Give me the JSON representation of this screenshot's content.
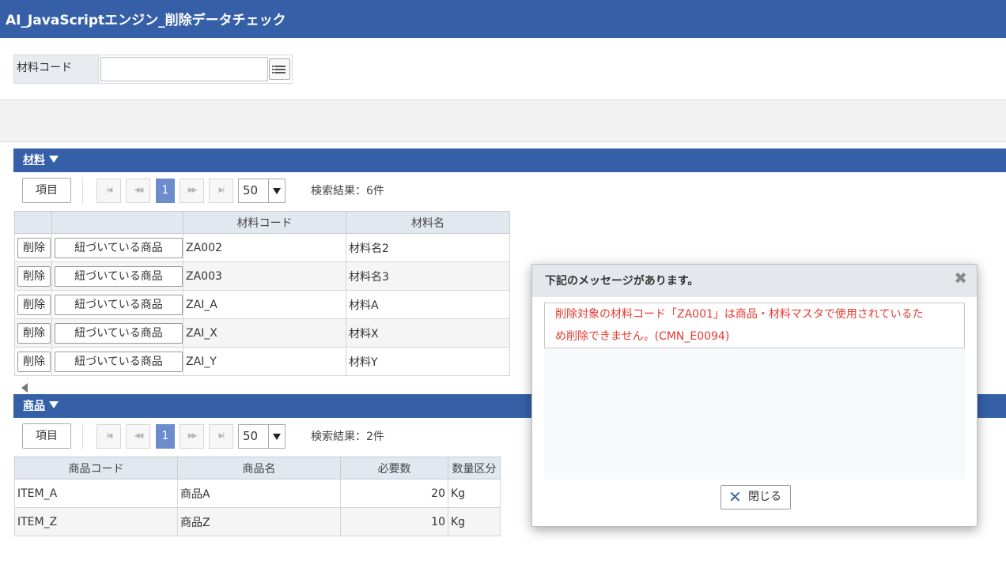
{
  "app": {
    "title": "AI_JavaScriptエンジン_削除データチェック"
  },
  "search": {
    "label": "材料コード",
    "value": "",
    "list_icon": "list-icon"
  },
  "materials": {
    "title": "材料",
    "item_button": "項目",
    "pager": {
      "first": "first-page-icon",
      "prev": "prev-page-icon",
      "current": "1",
      "next": "next-page-icon",
      "last": "last-page-icon",
      "per_page": "50"
    },
    "result_text": "検索結果：6件",
    "columns": [
      "",
      "",
      "材料コード",
      "材料名"
    ],
    "delete_label": "削除",
    "linked_label": "紐づいている商品",
    "rows": [
      {
        "code": "ZA002",
        "name": "材料名2"
      },
      {
        "code": "ZA003",
        "name": "材料名3"
      },
      {
        "code": "ZAI_A",
        "name": "材料A"
      },
      {
        "code": "ZAI_X",
        "name": "材料X"
      },
      {
        "code": "ZAI_Y",
        "name": "材料Y"
      }
    ]
  },
  "products": {
    "title": "商品",
    "item_button": "項目",
    "pager": {
      "current": "1",
      "per_page": "50"
    },
    "result_text": "検索結果：2件",
    "columns": [
      "商品コード",
      "商品名",
      "必要数",
      "数量区分"
    ],
    "rows": [
      {
        "code": "ITEM_A",
        "name": "商品A",
        "qty": "20",
        "unit": "Kg"
      },
      {
        "code": "ITEM_Z",
        "name": "商品Z",
        "qty": "10",
        "unit": "Kg"
      }
    ]
  },
  "dialog": {
    "title": "下記のメッセージがあります。",
    "message_line1": "削除対象の材料コード「ZA001」は商品・材料マスタで使用されているた",
    "message_line2": "め削除できません。(CMN_E0094)",
    "close_label": "閉じる"
  },
  "colors": {
    "header": "#3560a8",
    "error": "#e53a2f",
    "current_page": "#6d8ccc"
  }
}
